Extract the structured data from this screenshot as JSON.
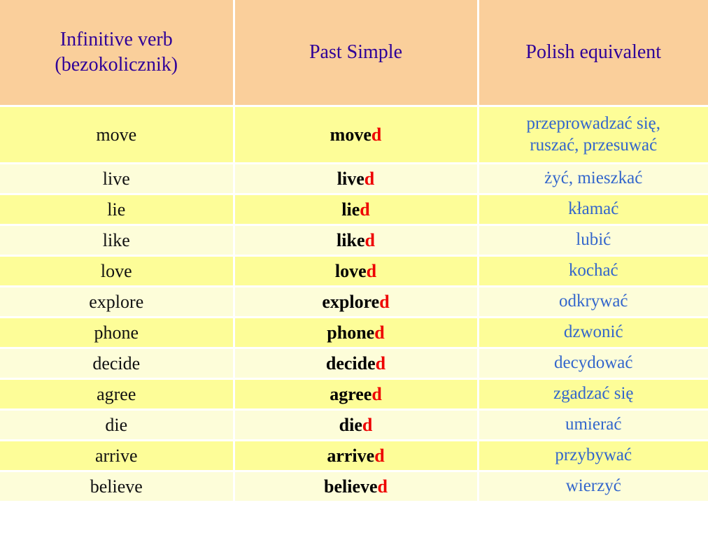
{
  "table": {
    "headers": [
      {
        "id": "infinitive",
        "line1": "Infinitive verb",
        "line2": "(bezokolicznik)"
      },
      {
        "id": "past-simple",
        "line1": "Past Simple",
        "line2": ""
      },
      {
        "id": "polish",
        "line1": "Polish equivalent",
        "line2": ""
      }
    ],
    "colors": {
      "header_background": "#facf9b",
      "header_text": "#2e0098",
      "row_background_odd": "#fdfd98",
      "row_background_even": "#fdfdd9",
      "infinitive_text": "#111111",
      "past_simple_text": "#000000",
      "suffix_text": "#ee0000",
      "polish_text": "#3366cc",
      "gridline": "#ffffff"
    },
    "rows": [
      {
        "infinitive": "move",
        "past_stem": "move",
        "past_suffix": "d",
        "polish_line1": "przeprowadzać się,",
        "polish_line2": "ruszać, przesuwać"
      },
      {
        "infinitive": "live",
        "past_stem": "live",
        "past_suffix": "d",
        "polish_line1": "żyć, mieszkać",
        "polish_line2": ""
      },
      {
        "infinitive": "lie",
        "past_stem": "lie",
        "past_suffix": "d",
        "polish_line1": "kłamać",
        "polish_line2": ""
      },
      {
        "infinitive": "like",
        "past_stem": "like",
        "past_suffix": "d",
        "polish_line1": "lubić",
        "polish_line2": ""
      },
      {
        "infinitive": "love",
        "past_stem": "love",
        "past_suffix": "d",
        "polish_line1": "kochać",
        "polish_line2": ""
      },
      {
        "infinitive": "explore",
        "past_stem": "explore",
        "past_suffix": "d",
        "polish_line1": "odkrywać",
        "polish_line2": ""
      },
      {
        "infinitive": "phone",
        "past_stem": "phone",
        "past_suffix": "d",
        "polish_line1": "dzwonić",
        "polish_line2": ""
      },
      {
        "infinitive": "decide",
        "past_stem": "decide",
        "past_suffix": "d",
        "polish_line1": "decydować",
        "polish_line2": ""
      },
      {
        "infinitive": "agree",
        "past_stem": "agree",
        "past_suffix": "d",
        "polish_line1": "zgadzać się",
        "polish_line2": ""
      },
      {
        "infinitive": "die",
        "past_stem": "die",
        "past_suffix": "d",
        "polish_line1": "umierać",
        "polish_line2": ""
      },
      {
        "infinitive": "arrive",
        "past_stem": "arrive",
        "past_suffix": "d",
        "polish_line1": "przybywać",
        "polish_line2": ""
      },
      {
        "infinitive": "believe",
        "past_stem": "believe",
        "past_suffix": "d",
        "polish_line1": "wierzyć",
        "polish_line2": ""
      }
    ]
  }
}
